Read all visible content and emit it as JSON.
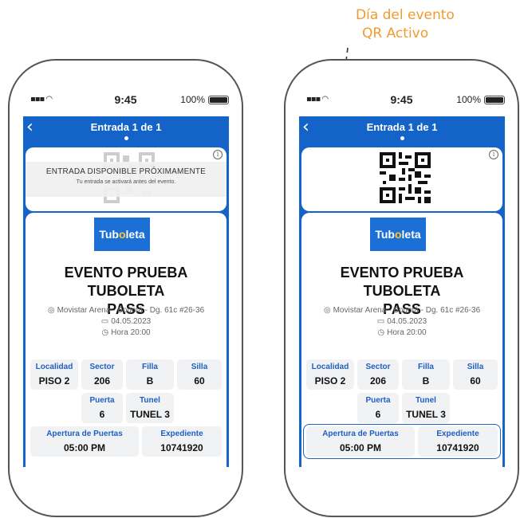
{
  "annotation": {
    "line1": "Día del evento",
    "line2": "QR Activo"
  },
  "status": {
    "time": "9:45",
    "battery": "100%",
    "signal": "▪▪▪ ◠"
  },
  "header": {
    "back": "‹",
    "title": "Entrada 1 de 1"
  },
  "pending": {
    "title": "ENTRADA DISPONIBLE PRÓXIMAMENTE",
    "subtitle": "Tu entrada se activará antes del evento."
  },
  "ticket": {
    "brand_pre": "Tub",
    "brand_o": "o",
    "brand_post": "leta",
    "title_line1": "EVENTO PRUEBA TUBOLETA",
    "title_line2": "PASS",
    "venue": "Movistar Arena - Bogotá - Dg. 61c #26-36",
    "date": "04.05.2023",
    "time": "Hora 20:00",
    "localidad_label": "Localidad",
    "localidad": "PISO 2",
    "sector_label": "Sector",
    "sector": "206",
    "fila_label": "Filla",
    "fila": "B",
    "silla_label": "Silla",
    "silla": "60",
    "puerta_label": "Puerta",
    "puerta": "6",
    "tunel_label": "Tunel",
    "tunel": "TUNEL 3",
    "apertura_label": "Apertura de Puertas",
    "apertura": "05:00 PM",
    "expediente_label": "Expediente",
    "expediente": "10741920"
  },
  "icons": {
    "location": "location-pin-icon",
    "calendar": "calendar-icon",
    "clock": "clock-icon",
    "info": "info-icon"
  },
  "colors": {
    "primary_blue": "#1463c8",
    "annotation_orange": "#f29a2e",
    "label_blue": "#1f5fc3"
  }
}
